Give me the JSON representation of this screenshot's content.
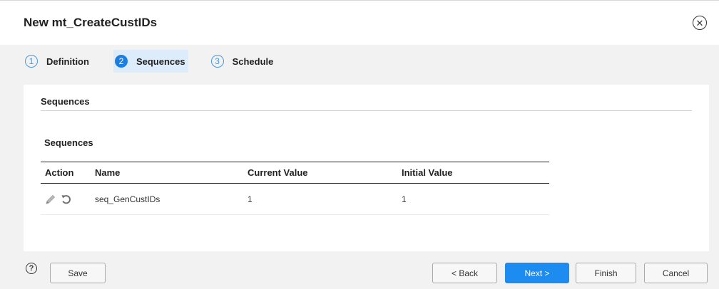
{
  "dialog": {
    "title": "New mt_CreateCustIDs",
    "close_icon": "close-circle-icon"
  },
  "steps": [
    {
      "number": "1",
      "label": "Definition",
      "active": false
    },
    {
      "number": "2",
      "label": "Sequences",
      "active": true
    },
    {
      "number": "3",
      "label": "Schedule",
      "active": false
    }
  ],
  "content": {
    "section_title": "Sequences",
    "table_title": "Sequences",
    "columns": [
      "Action",
      "Name",
      "Current Value",
      "Initial Value"
    ],
    "rows": [
      {
        "action_icons": [
          "pencil-edit-icon",
          "reset-icon"
        ],
        "name": "seq_GenCustIDs",
        "current_value": "1",
        "initial_value": "1"
      }
    ]
  },
  "footer": {
    "help_icon": "help-icon",
    "help_glyph": "?",
    "save_label": "Save",
    "back_label": "< Back",
    "next_label": "Next >",
    "finish_label": "Finish",
    "cancel_label": "Cancel"
  },
  "colors": {
    "accent": "#1d8cf0",
    "active_step_bg": "#dcecfb",
    "dialog_bg": "#f2f2f2"
  }
}
